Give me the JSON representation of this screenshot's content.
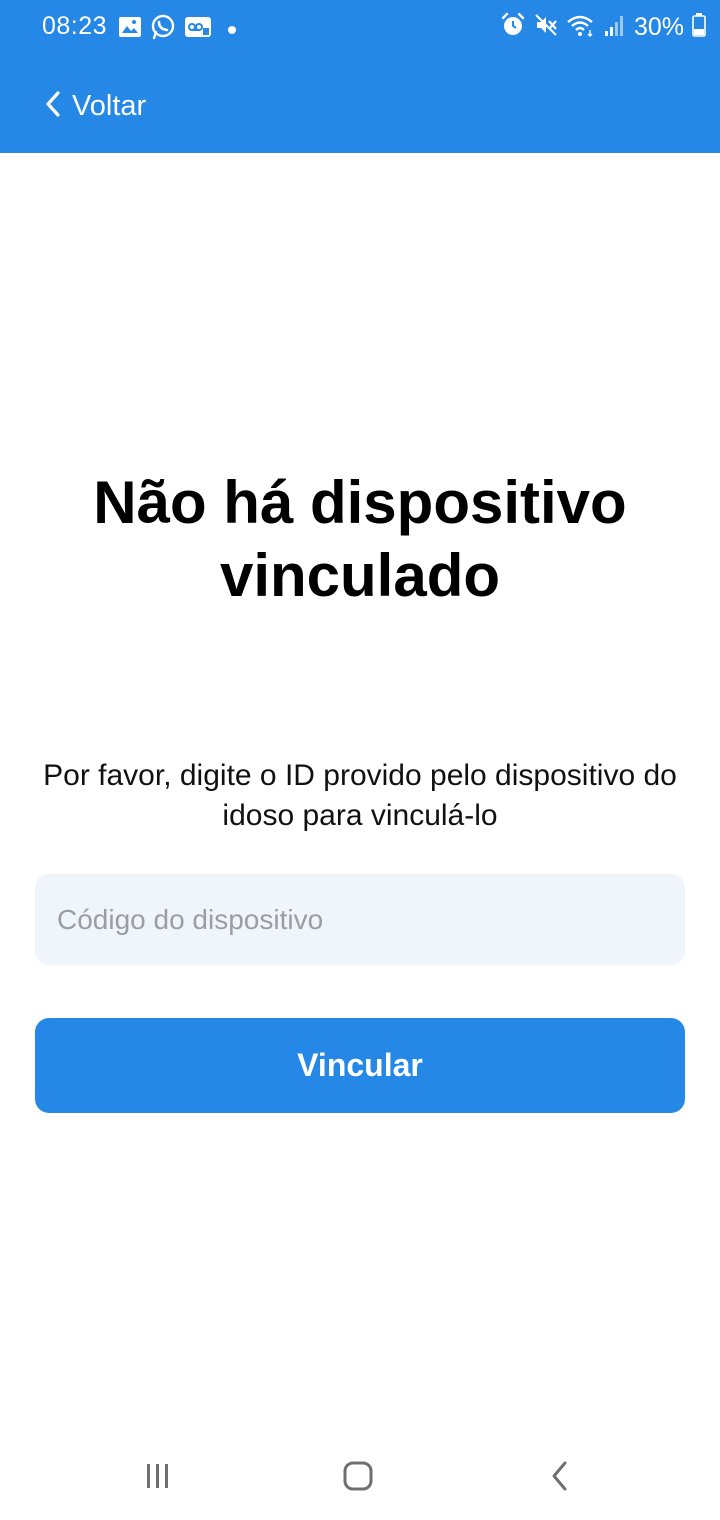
{
  "status_bar": {
    "time": "08:23",
    "battery": "30%",
    "left_icons": [
      "gallery-icon",
      "whatsapp-icon",
      "voicemail-icon",
      "dot-icon"
    ],
    "right_icons": [
      "alarm-icon",
      "mute-icon",
      "wifi-icon",
      "signal-icon",
      "battery-icon"
    ]
  },
  "header": {
    "back_label": "Voltar",
    "background_color": "#2587e6"
  },
  "main": {
    "title": "Não há dispositivo vinculado",
    "instructions": "Por favor, digite o ID provido pelo dispositivo do idoso para vinculá-lo",
    "device_code_input": {
      "value": "",
      "placeholder": "Código do dispositivo"
    },
    "link_button_label": "Vincular"
  },
  "nav_bar": {
    "icons": [
      "recents-icon",
      "home-icon",
      "back-nav-icon"
    ]
  },
  "colors": {
    "primary": "#2587e6",
    "input_background": "#f0f5fb",
    "title_text": "#000000"
  }
}
